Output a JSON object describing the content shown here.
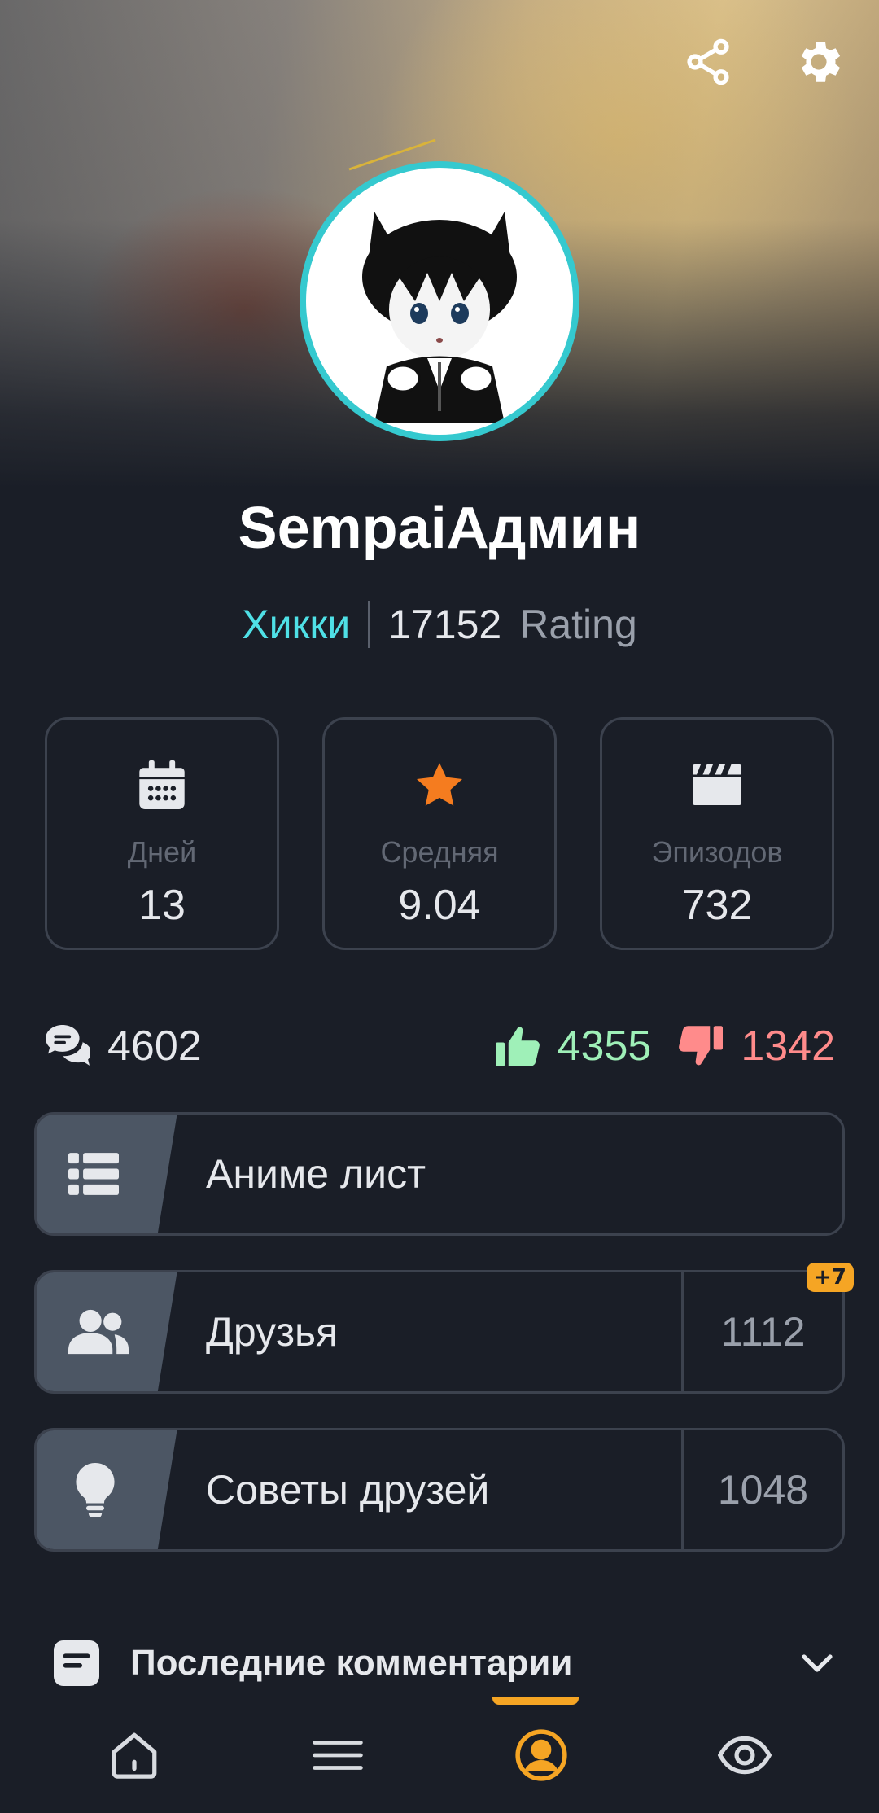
{
  "profile": {
    "username": "SempaiАдмин",
    "rank_title": "Хикки",
    "rating_value": "17152",
    "rating_label": "Rating"
  },
  "stats": [
    {
      "label": "Дней",
      "value": "13",
      "icon": "calendar-icon"
    },
    {
      "label": "Средняя",
      "value": "9.04",
      "icon": "star-icon"
    },
    {
      "label": "Эпизодов",
      "value": "732",
      "icon": "clapperboard-icon"
    }
  ],
  "metrics": {
    "comments": "4602",
    "likes": "4355",
    "dislikes": "1342"
  },
  "menu": {
    "anime_list": {
      "label": "Аниме лист",
      "icon": "list-icon"
    },
    "friends": {
      "label": "Друзья",
      "count": "1112",
      "badge": "+7",
      "icon": "users-icon"
    },
    "recommendations": {
      "label": "Советы друзей",
      "count": "1048",
      "icon": "lightbulb-icon"
    }
  },
  "section": {
    "title": "Последние комментарии"
  },
  "nav": [
    "home-icon",
    "menu-icon",
    "profile-icon",
    "eye-icon"
  ],
  "colors": {
    "accent": "#f5a524",
    "rank": "#4fe0e6",
    "likes": "#9ff0b8",
    "dislikes": "#ff8b8b",
    "background": "#1a1e27"
  }
}
